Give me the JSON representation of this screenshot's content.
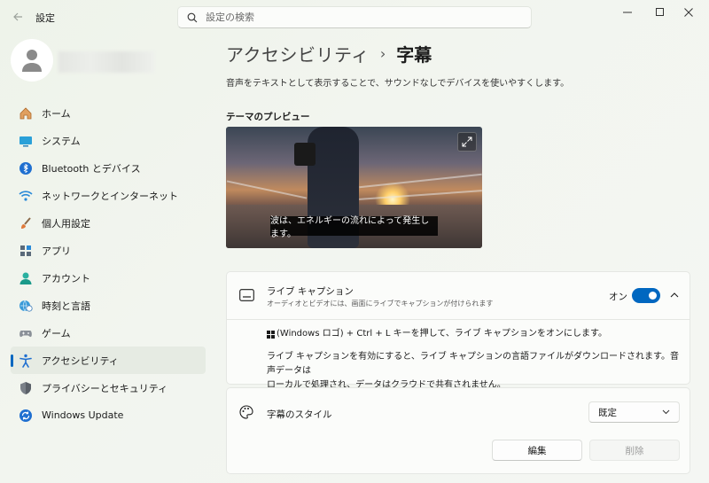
{
  "app": {
    "title": "設定"
  },
  "search": {
    "placeholder": "設定の検索"
  },
  "sidebar": {
    "items": [
      {
        "label": "ホーム",
        "icon": "home-icon"
      },
      {
        "label": "システム",
        "icon": "system-icon"
      },
      {
        "label": "Bluetooth とデバイス",
        "icon": "bluetooth-icon"
      },
      {
        "label": "ネットワークとインターネット",
        "icon": "wifi-icon"
      },
      {
        "label": "個人用設定",
        "icon": "brush-icon"
      },
      {
        "label": "アプリ",
        "icon": "apps-icon"
      },
      {
        "label": "アカウント",
        "icon": "account-icon"
      },
      {
        "label": "時刻と言語",
        "icon": "globe-clock-icon"
      },
      {
        "label": "ゲーム",
        "icon": "gamepad-icon"
      },
      {
        "label": "アクセシビリティ",
        "icon": "accessibility-icon",
        "active": true
      },
      {
        "label": "プライバシーとセキュリティ",
        "icon": "shield-icon"
      },
      {
        "label": "Windows Update",
        "icon": "update-icon"
      }
    ]
  },
  "main": {
    "breadcrumb_parent": "アクセシビリティ",
    "breadcrumb_separator": "›",
    "page_title": "字幕",
    "description": "音声をテキストとして表示することで、サウンドなしでデバイスを使いやすくします。",
    "preview_heading": "テーマのプレビュー",
    "preview_caption": "波は、エネルギーの流れによって発生します。",
    "live_caption": {
      "title": "ライブ キャプション",
      "subtitle": "オーディオとビデオには、画面にライブでキャプションが付けられます",
      "toggle_label": "オン",
      "toggle_on": true,
      "shortcut_text": "(Windows ロゴ) + Ctrl + L キーを押して、ライブ キャプションをオンにします。",
      "info_line1": "ライブ キャプションを有効にすると、ライブ キャプションの言語ファイルがダウンロードされます。音声データは",
      "info_line2": "ローカルで処理され、データはクラウドで共有されません。"
    },
    "caption_style": {
      "title": "字幕のスタイル",
      "selected": "既定",
      "edit_label": "編集",
      "delete_label": "削除"
    }
  },
  "colors": {
    "accent": "#0067c0"
  }
}
